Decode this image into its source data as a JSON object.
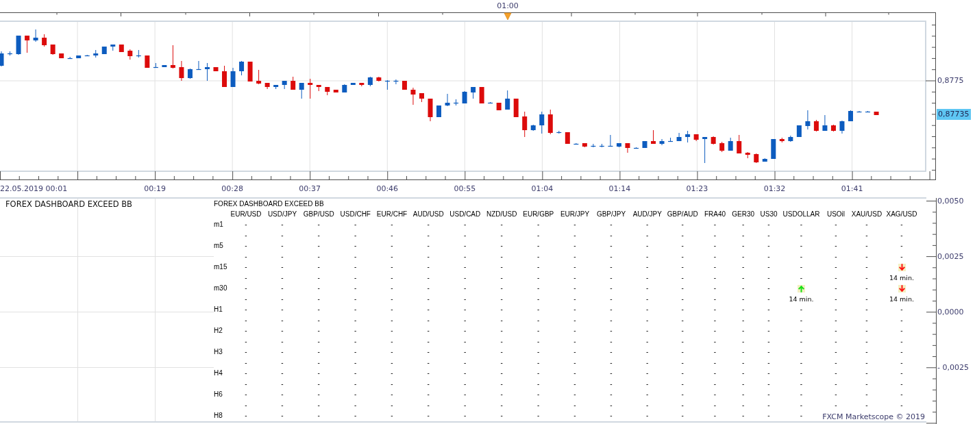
{
  "chart": {
    "marker": {
      "label": "01:00"
    },
    "price_axis": {
      "ticks": [
        "0,8775"
      ],
      "current_price": "0,87735"
    },
    "time_axis": {
      "labels": [
        "22.05.2019 00:01",
        "00:19",
        "00:28",
        "00:37",
        "00:46",
        "00:55",
        "01:04",
        "01:14",
        "01:23",
        "01:32",
        "01:41"
      ]
    }
  },
  "indicator_panel": {
    "title": "FOREX DASHBOARD EXCEED BB",
    "dashboard": {
      "title": "FOREX DASHBOARD EXCEED BB",
      "columns": [
        "EUR/USD",
        "USD/JPY",
        "GBP/USD",
        "USD/CHF",
        "EUR/CHF",
        "AUD/USD",
        "USD/CAD",
        "NZD/USD",
        "EUR/GBP",
        "EUR/JPY",
        "GBP/JPY",
        "AUD/JPY",
        "GBP/AUD",
        "FRA40",
        "GER30",
        "US30",
        "USDOLLAR",
        "USOil",
        "XAU/USD",
        "XAG/USD"
      ],
      "rows": [
        {
          "label": "m1",
          "cells": [
            {
              "kind": "dash",
              "signal": "-",
              "time": "-"
            },
            {
              "kind": "dash",
              "signal": "-",
              "time": "-"
            },
            {
              "kind": "dash",
              "signal": "-",
              "time": "-"
            },
            {
              "kind": "dash",
              "signal": "-",
              "time": "-"
            },
            {
              "kind": "dash",
              "signal": "-",
              "time": "-"
            },
            {
              "kind": "dash",
              "signal": "-",
              "time": "-"
            },
            {
              "kind": "dash",
              "signal": "-",
              "time": "-"
            },
            {
              "kind": "dash",
              "signal": "-",
              "time": "-"
            },
            {
              "kind": "dash",
              "signal": "-",
              "time": "-"
            },
            {
              "kind": "dash",
              "signal": "-",
              "time": "-"
            },
            {
              "kind": "dash",
              "signal": "-",
              "time": "-"
            },
            {
              "kind": "dash",
              "signal": "-",
              "time": "-"
            },
            {
              "kind": "dash",
              "signal": "-",
              "time": "-"
            },
            {
              "kind": "dash",
              "signal": "-",
              "time": "-"
            },
            {
              "kind": "dash",
              "signal": "-",
              "time": "-"
            },
            {
              "kind": "dash",
              "signal": "-",
              "time": "-"
            },
            {
              "kind": "dash",
              "signal": "-",
              "time": "-"
            },
            {
              "kind": "dash",
              "signal": "-",
              "time": "-"
            },
            {
              "kind": "dash",
              "signal": "-",
              "time": "-"
            },
            {
              "kind": "dash",
              "signal": "-",
              "time": "-"
            }
          ]
        },
        {
          "label": "m5",
          "cells": [
            {
              "kind": "dash",
              "signal": "-",
              "time": "-"
            },
            {
              "kind": "dash",
              "signal": "-",
              "time": "-"
            },
            {
              "kind": "dash",
              "signal": "-",
              "time": "-"
            },
            {
              "kind": "dash",
              "signal": "-",
              "time": "-"
            },
            {
              "kind": "dash",
              "signal": "-",
              "time": "-"
            },
            {
              "kind": "dash",
              "signal": "-",
              "time": "-"
            },
            {
              "kind": "dash",
              "signal": "-",
              "time": "-"
            },
            {
              "kind": "dash",
              "signal": "-",
              "time": "-"
            },
            {
              "kind": "dash",
              "signal": "-",
              "time": "-"
            },
            {
              "kind": "dash",
              "signal": "-",
              "time": "-"
            },
            {
              "kind": "dash",
              "signal": "-",
              "time": "-"
            },
            {
              "kind": "dash",
              "signal": "-",
              "time": "-"
            },
            {
              "kind": "dash",
              "signal": "-",
              "time": "-"
            },
            {
              "kind": "dash",
              "signal": "-",
              "time": "-"
            },
            {
              "kind": "dash",
              "signal": "-",
              "time": "-"
            },
            {
              "kind": "dash",
              "signal": "-",
              "time": "-"
            },
            {
              "kind": "dash",
              "signal": "-",
              "time": "-"
            },
            {
              "kind": "dash",
              "signal": "-",
              "time": "-"
            },
            {
              "kind": "dash",
              "signal": "-",
              "time": "-"
            },
            {
              "kind": "dash",
              "signal": "-",
              "time": "-"
            }
          ]
        },
        {
          "label": "m15",
          "cells": [
            {
              "kind": "dash",
              "signal": "-",
              "time": "-"
            },
            {
              "kind": "dash",
              "signal": "-",
              "time": "-"
            },
            {
              "kind": "dash",
              "signal": "-",
              "time": "-"
            },
            {
              "kind": "dash",
              "signal": "-",
              "time": "-"
            },
            {
              "kind": "dash",
              "signal": "-",
              "time": "-"
            },
            {
              "kind": "dash",
              "signal": "-",
              "time": "-"
            },
            {
              "kind": "dash",
              "signal": "-",
              "time": "-"
            },
            {
              "kind": "dash",
              "signal": "-",
              "time": "-"
            },
            {
              "kind": "dash",
              "signal": "-",
              "time": "-"
            },
            {
              "kind": "dash",
              "signal": "-",
              "time": "-"
            },
            {
              "kind": "dash",
              "signal": "-",
              "time": "-"
            },
            {
              "kind": "dash",
              "signal": "-",
              "time": "-"
            },
            {
              "kind": "dash",
              "signal": "-",
              "time": "-"
            },
            {
              "kind": "dash",
              "signal": "-",
              "time": "-"
            },
            {
              "kind": "dash",
              "signal": "-",
              "time": "-"
            },
            {
              "kind": "dash",
              "signal": "-",
              "time": "-"
            },
            {
              "kind": "dash",
              "signal": "-",
              "time": "-"
            },
            {
              "kind": "dash",
              "signal": "-",
              "time": "-"
            },
            {
              "kind": "dash",
              "signal": "-",
              "time": "-"
            },
            {
              "kind": "down",
              "time": "14 min."
            }
          ]
        },
        {
          "label": "m30",
          "cells": [
            {
              "kind": "dash",
              "signal": "-",
              "time": "-"
            },
            {
              "kind": "dash",
              "signal": "-",
              "time": "-"
            },
            {
              "kind": "dash",
              "signal": "-",
              "time": "-"
            },
            {
              "kind": "dash",
              "signal": "-",
              "time": "-"
            },
            {
              "kind": "dash",
              "signal": "-",
              "time": "-"
            },
            {
              "kind": "dash",
              "signal": "-",
              "time": "-"
            },
            {
              "kind": "dash",
              "signal": "-",
              "time": "-"
            },
            {
              "kind": "dash",
              "signal": "-",
              "time": "-"
            },
            {
              "kind": "dash",
              "signal": "-",
              "time": "-"
            },
            {
              "kind": "dash",
              "signal": "-",
              "time": "-"
            },
            {
              "kind": "dash",
              "signal": "-",
              "time": "-"
            },
            {
              "kind": "dash",
              "signal": "-",
              "time": "-"
            },
            {
              "kind": "dash",
              "signal": "-",
              "time": "-"
            },
            {
              "kind": "dash",
              "signal": "-",
              "time": "-"
            },
            {
              "kind": "dash",
              "signal": "-",
              "time": "-"
            },
            {
              "kind": "dash",
              "signal": "-",
              "time": "-"
            },
            {
              "kind": "up",
              "time": "14 min."
            },
            {
              "kind": "dash",
              "signal": "-",
              "time": "-"
            },
            {
              "kind": "dash",
              "signal": "-",
              "time": "-"
            },
            {
              "kind": "down",
              "time": "14 min."
            }
          ]
        },
        {
          "label": "H1",
          "cells": [
            {
              "kind": "dash",
              "signal": "-",
              "time": "-"
            },
            {
              "kind": "dash",
              "signal": "-",
              "time": "-"
            },
            {
              "kind": "dash",
              "signal": "-",
              "time": "-"
            },
            {
              "kind": "dash",
              "signal": "-",
              "time": "-"
            },
            {
              "kind": "dash",
              "signal": "-",
              "time": "-"
            },
            {
              "kind": "dash",
              "signal": "-",
              "time": "-"
            },
            {
              "kind": "dash",
              "signal": "-",
              "time": "-"
            },
            {
              "kind": "dash",
              "signal": "-",
              "time": "-"
            },
            {
              "kind": "dash",
              "signal": "-",
              "time": "-"
            },
            {
              "kind": "dash",
              "signal": "-",
              "time": "-"
            },
            {
              "kind": "dash",
              "signal": "-",
              "time": "-"
            },
            {
              "kind": "dash",
              "signal": "-",
              "time": "-"
            },
            {
              "kind": "dash",
              "signal": "-",
              "time": "-"
            },
            {
              "kind": "dash",
              "signal": "-",
              "time": "-"
            },
            {
              "kind": "dash",
              "signal": "-",
              "time": "-"
            },
            {
              "kind": "dash",
              "signal": "-",
              "time": "-"
            },
            {
              "kind": "dash",
              "signal": "-",
              "time": "-"
            },
            {
              "kind": "dash",
              "signal": "-",
              "time": "-"
            },
            {
              "kind": "dash",
              "signal": "-",
              "time": "-"
            },
            {
              "kind": "dash",
              "signal": "-",
              "time": "-"
            }
          ]
        },
        {
          "label": "H2",
          "cells": [
            {
              "kind": "dash",
              "signal": "-",
              "time": "-"
            },
            {
              "kind": "dash",
              "signal": "-",
              "time": "-"
            },
            {
              "kind": "dash",
              "signal": "-",
              "time": "-"
            },
            {
              "kind": "dash",
              "signal": "-",
              "time": "-"
            },
            {
              "kind": "dash",
              "signal": "-",
              "time": "-"
            },
            {
              "kind": "dash",
              "signal": "-",
              "time": "-"
            },
            {
              "kind": "dash",
              "signal": "-",
              "time": "-"
            },
            {
              "kind": "dash",
              "signal": "-",
              "time": "-"
            },
            {
              "kind": "dash",
              "signal": "-",
              "time": "-"
            },
            {
              "kind": "dash",
              "signal": "-",
              "time": "-"
            },
            {
              "kind": "dash",
              "signal": "-",
              "time": "-"
            },
            {
              "kind": "dash",
              "signal": "-",
              "time": "-"
            },
            {
              "kind": "dash",
              "signal": "-",
              "time": "-"
            },
            {
              "kind": "dash",
              "signal": "-",
              "time": "-"
            },
            {
              "kind": "dash",
              "signal": "-",
              "time": "-"
            },
            {
              "kind": "dash",
              "signal": "-",
              "time": "-"
            },
            {
              "kind": "dash",
              "signal": "-",
              "time": "-"
            },
            {
              "kind": "dash",
              "signal": "-",
              "time": "-"
            },
            {
              "kind": "dash",
              "signal": "-",
              "time": "-"
            },
            {
              "kind": "dash",
              "signal": "-",
              "time": "-"
            }
          ]
        },
        {
          "label": "H3",
          "cells": [
            {
              "kind": "dash",
              "signal": "-",
              "time": "-"
            },
            {
              "kind": "dash",
              "signal": "-",
              "time": "-"
            },
            {
              "kind": "dash",
              "signal": "-",
              "time": "-"
            },
            {
              "kind": "dash",
              "signal": "-",
              "time": "-"
            },
            {
              "kind": "dash",
              "signal": "-",
              "time": "-"
            },
            {
              "kind": "dash",
              "signal": "-",
              "time": "-"
            },
            {
              "kind": "dash",
              "signal": "-",
              "time": "-"
            },
            {
              "kind": "dash",
              "signal": "-",
              "time": "-"
            },
            {
              "kind": "dash",
              "signal": "-",
              "time": "-"
            },
            {
              "kind": "dash",
              "signal": "-",
              "time": "-"
            },
            {
              "kind": "dash",
              "signal": "-",
              "time": "-"
            },
            {
              "kind": "dash",
              "signal": "-",
              "time": "-"
            },
            {
              "kind": "dash",
              "signal": "-",
              "time": "-"
            },
            {
              "kind": "dash",
              "signal": "-",
              "time": "-"
            },
            {
              "kind": "dash",
              "signal": "-",
              "time": "-"
            },
            {
              "kind": "dash",
              "signal": "-",
              "time": "-"
            },
            {
              "kind": "dash",
              "signal": "-",
              "time": "-"
            },
            {
              "kind": "dash",
              "signal": "-",
              "time": "-"
            },
            {
              "kind": "dash",
              "signal": "-",
              "time": "-"
            },
            {
              "kind": "dash",
              "signal": "-",
              "time": "-"
            }
          ]
        },
        {
          "label": "H4",
          "cells": [
            {
              "kind": "dash",
              "signal": "-",
              "time": "-"
            },
            {
              "kind": "dash",
              "signal": "-",
              "time": "-"
            },
            {
              "kind": "dash",
              "signal": "-",
              "time": "-"
            },
            {
              "kind": "dash",
              "signal": "-",
              "time": "-"
            },
            {
              "kind": "dash",
              "signal": "-",
              "time": "-"
            },
            {
              "kind": "dash",
              "signal": "-",
              "time": "-"
            },
            {
              "kind": "dash",
              "signal": "-",
              "time": "-"
            },
            {
              "kind": "dash",
              "signal": "-",
              "time": "-"
            },
            {
              "kind": "dash",
              "signal": "-",
              "time": "-"
            },
            {
              "kind": "dash",
              "signal": "-",
              "time": "-"
            },
            {
              "kind": "dash",
              "signal": "-",
              "time": "-"
            },
            {
              "kind": "dash",
              "signal": "-",
              "time": "-"
            },
            {
              "kind": "dash",
              "signal": "-",
              "time": "-"
            },
            {
              "kind": "dash",
              "signal": "-",
              "time": "-"
            },
            {
              "kind": "dash",
              "signal": "-",
              "time": "-"
            },
            {
              "kind": "dash",
              "signal": "-",
              "time": "-"
            },
            {
              "kind": "dash",
              "signal": "-",
              "time": "-"
            },
            {
              "kind": "dash",
              "signal": "-",
              "time": "-"
            },
            {
              "kind": "dash",
              "signal": "-",
              "time": "-"
            },
            {
              "kind": "dash",
              "signal": "-",
              "time": "-"
            }
          ]
        },
        {
          "label": "H6",
          "cells": [
            {
              "kind": "dash",
              "signal": "-",
              "time": "-"
            },
            {
              "kind": "dash",
              "signal": "-",
              "time": "-"
            },
            {
              "kind": "dash",
              "signal": "-",
              "time": "-"
            },
            {
              "kind": "dash",
              "signal": "-",
              "time": "-"
            },
            {
              "kind": "dash",
              "signal": "-",
              "time": "-"
            },
            {
              "kind": "dash",
              "signal": "-",
              "time": "-"
            },
            {
              "kind": "dash",
              "signal": "-",
              "time": "-"
            },
            {
              "kind": "dash",
              "signal": "-",
              "time": "-"
            },
            {
              "kind": "dash",
              "signal": "-",
              "time": "-"
            },
            {
              "kind": "dash",
              "signal": "-",
              "time": "-"
            },
            {
              "kind": "dash",
              "signal": "-",
              "time": "-"
            },
            {
              "kind": "dash",
              "signal": "-",
              "time": "-"
            },
            {
              "kind": "dash",
              "signal": "-",
              "time": "-"
            },
            {
              "kind": "dash",
              "signal": "-",
              "time": "-"
            },
            {
              "kind": "dash",
              "signal": "-",
              "time": "-"
            },
            {
              "kind": "dash",
              "signal": "-",
              "time": "-"
            },
            {
              "kind": "dash",
              "signal": "-",
              "time": "-"
            },
            {
              "kind": "dash",
              "signal": "-",
              "time": "-"
            },
            {
              "kind": "dash",
              "signal": "-",
              "time": "-"
            },
            {
              "kind": "dash",
              "signal": "-",
              "time": "-"
            }
          ]
        },
        {
          "label": "H8",
          "cells": [
            {
              "kind": "dash",
              "signal": "-"
            },
            {
              "kind": "dash",
              "signal": "-"
            },
            {
              "kind": "dash",
              "signal": "-"
            },
            {
              "kind": "dash",
              "signal": "-"
            },
            {
              "kind": "dash",
              "signal": "-"
            },
            {
              "kind": "dash",
              "signal": "-"
            },
            {
              "kind": "dash",
              "signal": "-"
            },
            {
              "kind": "dash",
              "signal": "-"
            },
            {
              "kind": "dash",
              "signal": "-"
            },
            {
              "kind": "dash",
              "signal": "-"
            },
            {
              "kind": "dash",
              "signal": "-"
            },
            {
              "kind": "dash",
              "signal": "-"
            },
            {
              "kind": "dash",
              "signal": "-"
            },
            {
              "kind": "dash",
              "signal": "-"
            },
            {
              "kind": "dash",
              "signal": "-"
            },
            {
              "kind": "dash",
              "signal": "-"
            },
            {
              "kind": "dash",
              "signal": "-"
            }
          ]
        }
      ]
    },
    "value_axis": {
      "ticks": [
        "0,0050",
        "0,0025",
        "0,0000",
        "- 0,0025"
      ]
    },
    "footer": "FXCM Marketscope © 2019"
  }
}
